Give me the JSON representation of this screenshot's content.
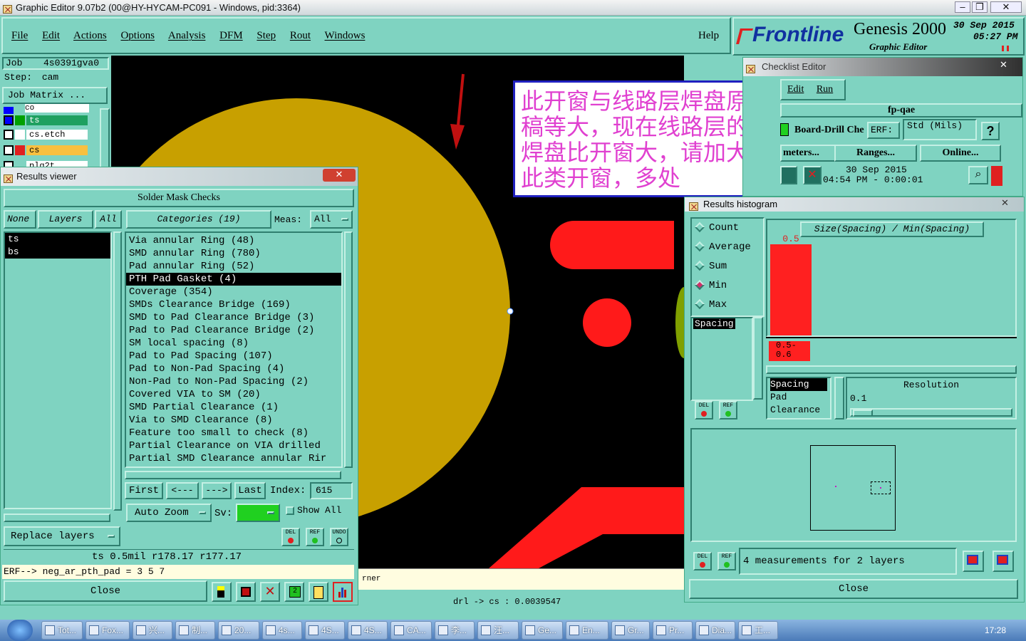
{
  "window": {
    "title": "Graphic Editor 9.07b2 (00@HY-HYCAM-PC091 - Windows, pid:3364)"
  },
  "menu": {
    "items": [
      "File",
      "Edit",
      "Actions",
      "Options",
      "Analysis",
      "DFM",
      "Step",
      "Rout",
      "Windows"
    ],
    "help": "Help"
  },
  "brand": {
    "logo": "Frontline",
    "product": "Genesis 2000",
    "subtitle": "Graphic Editor",
    "date": "30 Sep 2015",
    "time": "05:27 PM"
  },
  "job": {
    "job_label": "Job",
    "job_value": "4s0391gva0",
    "step_label": "Step:",
    "step_value": "cam",
    "matrix_button": "Job Matrix ..."
  },
  "layers_panel": {
    "items": [
      {
        "name": "co"
      },
      {
        "name": "ts"
      },
      {
        "name": "cs.etch"
      },
      {
        "name": "cs"
      },
      {
        "name": "plg2t"
      }
    ]
  },
  "annotation": {
    "text": "此开窗与线路层焊盘原稿等大，现在线路层的焊盘比开窗大，请加大此类开窗，多处"
  },
  "status": {
    "bottom_right": "drl -> cs : 0.0039547",
    "partial_text": "rner"
  },
  "results_viewer": {
    "title": "Results viewer",
    "header": "Solder Mask Checks",
    "buttons": {
      "none": "None",
      "layers": "Layers",
      "all": "All",
      "categories": "Categories (19)",
      "meas_label": "Meas:",
      "meas_value": "All"
    },
    "layers": [
      "ts",
      "bs"
    ],
    "categories": [
      "Via annular Ring (48)",
      "SMD annular Ring (780)",
      "Pad annular Ring (52)",
      "PTH Pad Gasket (4)",
      "Coverage (354)",
      "SMDs Clearance Bridge (169)",
      "SMD to Pad Clearance Bridge (3)",
      "Pad to Pad Clearance Bridge (2)",
      "SM local spacing (8)",
      "Pad to Pad Spacing (107)",
      "Pad to Non-Pad Spacing (4)",
      "Non-Pad to Non-Pad Spacing (2)",
      "Covered VIA to SM (20)",
      "SMD Partial Clearance (1)",
      "Via to SMD Clearance (8)",
      "Feature too small to check (8)",
      "Partial Clearance on VIA drilled",
      "Partial SMD Clearance annular Rir"
    ],
    "nav": {
      "first": "First",
      "prev": "<---",
      "next": "--->",
      "last": "Last",
      "index_label": "Index:",
      "index_value": "615"
    },
    "zoom": "Auto Zoom",
    "sv_label": "Sv:",
    "show_all": "Show All",
    "replace": "Replace layers",
    "small": {
      "del": "DEL",
      "ref": "REF",
      "undo": "UNDO"
    },
    "info_line": "ts 0.5mil   r178.17   r177.17",
    "erf_line": "ERF--> neg_ar_pth_pad = 3 5 7",
    "close": "Close"
  },
  "checklist": {
    "title": "Checklist Editor",
    "menu": [
      "Edit",
      "Run"
    ],
    "name": "fp-qae",
    "board": "Board-Drill Che",
    "erf": "ERF:",
    "std": "Std (Mils)",
    "help": "?",
    "buttons": [
      "meters...",
      "Ranges...",
      "Online..."
    ],
    "date": "30 Sep 2015",
    "time": "04:54 PM - 0:00:01"
  },
  "histogram": {
    "title": "Results histogram",
    "options": [
      {
        "label": "Count",
        "on": false
      },
      {
        "label": "Average",
        "on": false
      },
      {
        "label": "Sum",
        "on": false
      },
      {
        "label": "Min",
        "on": true
      },
      {
        "label": "Max",
        "on": false
      }
    ],
    "metric": "Spacing",
    "graph_title": "Size(Spacing) / Min(Spacing)",
    "bar_value_label": "0.5",
    "bar_range_label": "0.5- 0.6",
    "sub_list": [
      "Spacing",
      "Pad",
      "Clearance"
    ],
    "resolution_label": "Resolution",
    "resolution_value": "0.1",
    "measurements": "4 measurements for 2 layers",
    "close": "Close"
  },
  "chart_data": {
    "type": "bar",
    "title": "Size(Spacing) / Min(Spacing)",
    "categories": [
      "0.5- 0.6"
    ],
    "values": [
      0.5
    ],
    "color": "#ff2020"
  },
  "taskbar": {
    "items": [
      "Tot...",
      "Fox...",
      "兴...",
      "制...",
      "20...",
      "4s...",
      "4S...",
      "4S...",
      "CA...",
      "李...",
      "汪...",
      "Ge...",
      "En...",
      "Gr...",
      "Pr...",
      "Dia...",
      "工..."
    ],
    "clock": "17:28"
  },
  "colors": {
    "teal": "#7fd3c1",
    "pad_gold": "#c8a000",
    "red": "#ff1a1a",
    "annotation_text": "#e040d0"
  }
}
